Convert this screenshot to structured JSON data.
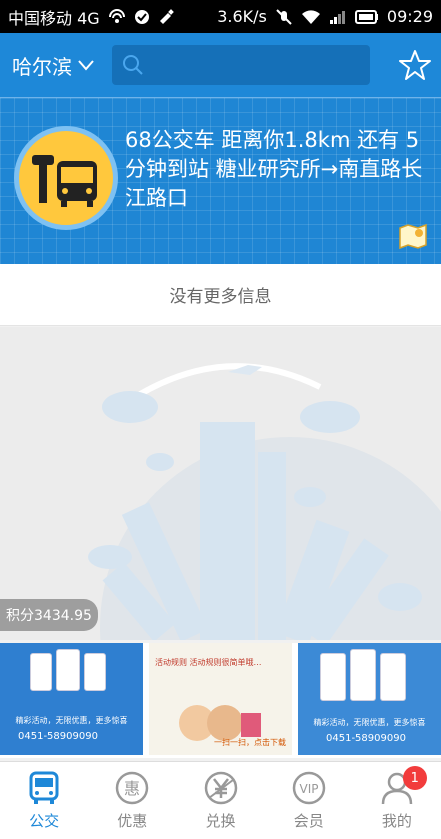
{
  "status_bar": {
    "carrier": "中国移动 4G",
    "speed": "3.6K/s",
    "time": "09:29"
  },
  "header": {
    "city": "哈尔滨",
    "search_placeholder": ""
  },
  "banner": {
    "text": "68公交车  距离你1.8km 还有 5 分钟到站 糖业研究所→南直路长江路口"
  },
  "feed": {
    "no_more": "没有更多信息"
  },
  "points": {
    "label": "积分3434.95"
  },
  "ads": [
    {
      "line1": "精彩活动，无限优惠，更多惊喜",
      "phone": "0451-58909090"
    },
    {
      "line1": "活动规则 活动规则很简单哦…",
      "line2": "一扫一扫，点击下载"
    },
    {
      "line1": "精彩活动，无限优惠，更多惊喜",
      "phone": "0451-58909090"
    }
  ],
  "tabs": [
    {
      "label": "公交",
      "icon": "bus-icon",
      "active": true
    },
    {
      "label": "优惠",
      "icon": "discount-icon",
      "active": false
    },
    {
      "label": "兑换",
      "icon": "exchange-icon",
      "active": false
    },
    {
      "label": "会员",
      "icon": "vip-icon",
      "active": false
    },
    {
      "label": "我的",
      "icon": "user-icon",
      "active": false,
      "badge": "1"
    }
  ],
  "colors": {
    "brand_blue": "#1e88d8",
    "badge_red": "#f23c3c",
    "bus_yellow": "#ffc83d"
  }
}
